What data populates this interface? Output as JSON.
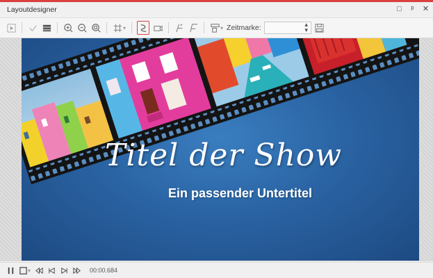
{
  "window": {
    "title": "Layoutdesigner",
    "buttons": [
      "□",
      "ᵖ",
      "✕"
    ]
  },
  "toolbar": {
    "zeitmarke_label": "Zeitmarke:",
    "zeitmarke_value": "",
    "icons": [
      "select-icon",
      "check-icon",
      "layers-icon",
      "zoom-in-icon",
      "zoom-out-icon",
      "zoom-fit-icon",
      "grid-icon",
      "path-icon",
      "camera-icon",
      "motion-a-icon",
      "motion-b-icon",
      "align-icon",
      "save-icon"
    ]
  },
  "canvas": {
    "title": "Titel der Show",
    "subtitle": "Ein passender Untertitel",
    "background_color": "#2a63a3"
  },
  "playback": {
    "time": "00:00.684"
  }
}
